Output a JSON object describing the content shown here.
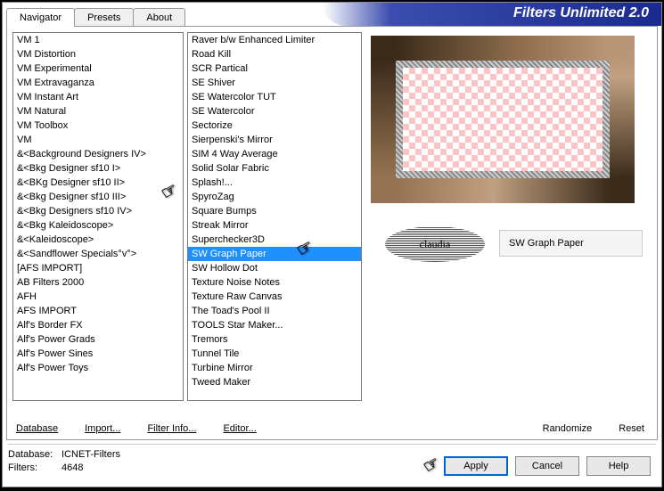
{
  "title": "Filters Unlimited 2.0",
  "tabs": {
    "navigator": "Navigator",
    "presets": "Presets",
    "about": "About"
  },
  "list1": [
    "VM 1",
    "VM Distortion",
    "VM Experimental",
    "VM Extravaganza",
    "VM Instant Art",
    "VM Natural",
    "VM Toolbox",
    "VM",
    "&<Background Designers IV>",
    "&<Bkg Designer sf10 I>",
    "&<BKg Designer sf10 II>",
    "&<Bkg Designer sf10 III>",
    "&<Bkg Designers sf10 IV>",
    "&<Bkg Kaleidoscope>",
    "&<Kaleidoscope>",
    "&<Sandflower Specials°v°>",
    "[AFS IMPORT]",
    "AB Filters 2000",
    "AFH",
    "AFS IMPORT",
    "Alf's Border FX",
    "Alf's Power Grads",
    "Alf's Power Sines",
    "Alf's Power Toys"
  ],
  "list2": [
    "Raver b/w Enhanced Limiter",
    "Road Kill",
    "SCR Partical",
    "SE Shiver",
    "SE Watercolor TUT",
    "SE Watercolor",
    "Sectorize",
    "Sierpenski's Mirror",
    "SIM 4 Way Average",
    "Solid Solar Fabric",
    "Splash!...",
    "SpyroZag",
    "Square Bumps",
    "Streak Mirror",
    "Superchecker3D",
    "SW Graph Paper",
    "SW Hollow Dot",
    "Texture Noise Notes",
    "Texture Raw Canvas",
    "The Toad's Pool II",
    "TOOLS Star Maker...",
    "Tremors",
    "Tunnel Tile",
    "Turbine Mirror",
    "Tweed Maker"
  ],
  "selected2_index": 15,
  "filter_name": "SW Graph Paper",
  "watermark": "claudia",
  "links": {
    "database": "Database",
    "import": "Import...",
    "filterinfo": "Filter Info...",
    "editor": "Editor..."
  },
  "rlinks": {
    "randomize": "Randomize",
    "reset": "Reset"
  },
  "info": {
    "db_label": "Database:",
    "db_value": "ICNET-Filters",
    "filters_label": "Filters:",
    "filters_value": "4648"
  },
  "buttons": {
    "apply": "Apply",
    "cancel": "Cancel",
    "help": "Help"
  }
}
